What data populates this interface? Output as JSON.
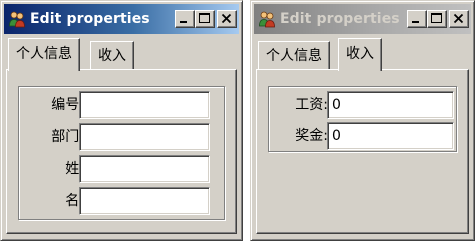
{
  "windows": [
    {
      "title": "Edit properties",
      "state": "active",
      "tabs": [
        {
          "label": "个人信息",
          "selected": true
        },
        {
          "label": "收入",
          "selected": false
        }
      ],
      "fields": [
        {
          "label": "编号:",
          "value": ""
        },
        {
          "label": "部门:",
          "value": ""
        },
        {
          "label": "姓:",
          "value": ""
        },
        {
          "label": "名:",
          "value": ""
        }
      ]
    },
    {
      "title": "Edit properties",
      "state": "inactive",
      "tabs": [
        {
          "label": "个人信息",
          "selected": false
        },
        {
          "label": "收入",
          "selected": true
        }
      ],
      "fields": [
        {
          "label": "工资:",
          "value": "0"
        },
        {
          "label": "奖金:",
          "value": "0"
        }
      ]
    }
  ],
  "icons": {
    "app": "people-icon",
    "minimize": "minimize-icon",
    "maximize": "maximize-icon",
    "close": "close-icon"
  },
  "colors": {
    "face": "#d4d0c8",
    "active_title_start": "#0a246a",
    "active_title_end": "#a6caf0",
    "inactive_title_start": "#808080",
    "inactive_title_end": "#c0c0c0"
  }
}
